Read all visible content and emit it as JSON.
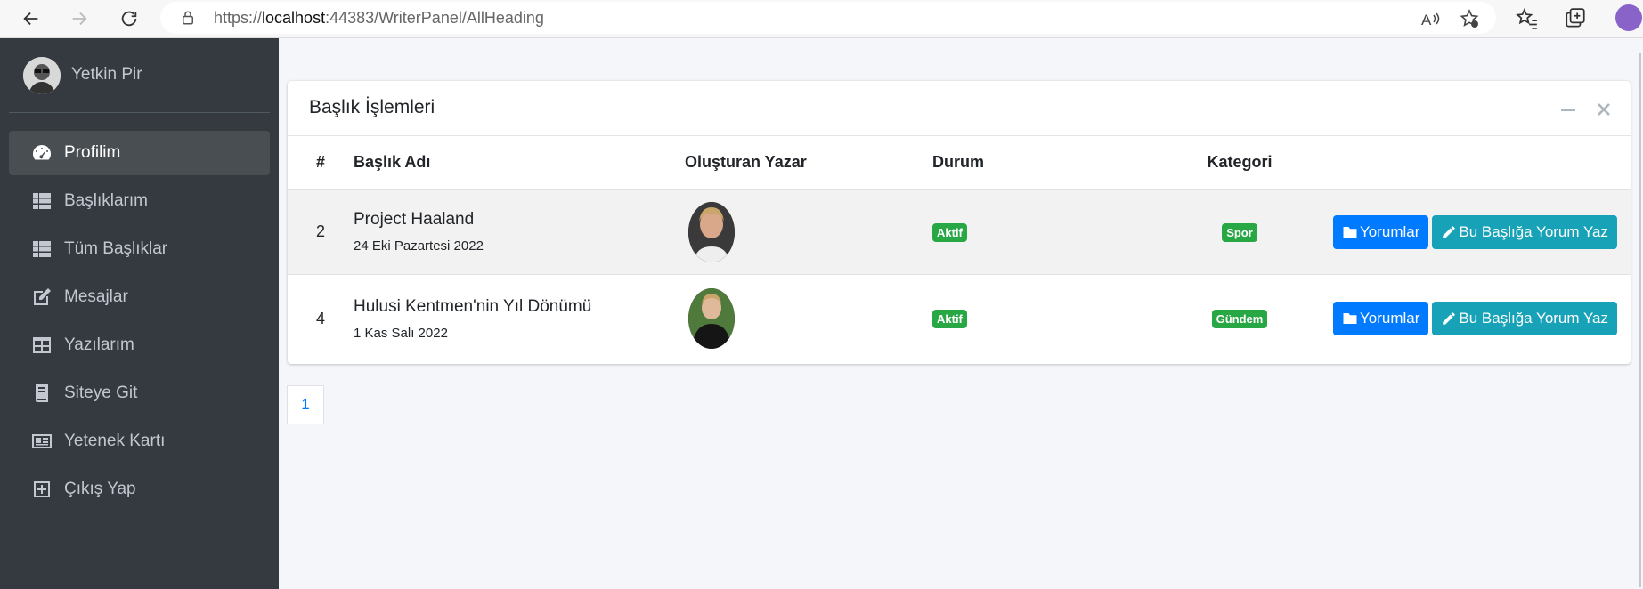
{
  "browser": {
    "url_prefix": "https://",
    "url_host": "localhost",
    "url_path": ":44383/WriterPanel/AllHeading"
  },
  "sidebar": {
    "user_name": "Yetkin Pir",
    "items": [
      {
        "label": "Profilim",
        "icon": "dashboard-icon",
        "active": true
      },
      {
        "label": "Başlıklarım",
        "icon": "grid-icon"
      },
      {
        "label": "Tüm Başlıklar",
        "icon": "list-icon"
      },
      {
        "label": "Mesajlar",
        "icon": "edit-icon"
      },
      {
        "label": "Yazılarım",
        "icon": "layout-icon"
      },
      {
        "label": "Siteye Git",
        "icon": "book-icon"
      },
      {
        "label": "Yetenek Kartı",
        "icon": "id-card-icon"
      },
      {
        "label": "Çıkış Yap",
        "icon": "plus-square-icon"
      }
    ]
  },
  "card": {
    "title": "Başlık İşlemleri",
    "columns": [
      "#",
      "Başlık Adı",
      "Oluşturan Yazar",
      "Durum",
      "Kategori"
    ],
    "rows": [
      {
        "id": "2",
        "title": "Project Haaland",
        "date": "24 Eki Pazartesi 2022",
        "status": "Aktif",
        "category": "Spor",
        "comments_label": "Yorumlar",
        "write_label": "Bu Başlığa Yorum Yaz"
      },
      {
        "id": "4",
        "title": "Hulusi Kentmen'nin Yıl Dönümü",
        "date": "1 Kas Salı 2022",
        "status": "Aktif",
        "category": "Gündem",
        "comments_label": "Yorumlar",
        "write_label": "Bu Başlığa Yorum Yaz"
      }
    ]
  },
  "pagination": {
    "current": "1"
  },
  "colors": {
    "sidebar": "#343a40",
    "primary": "#007bff",
    "info": "#17a2b8",
    "success": "#28a745"
  }
}
